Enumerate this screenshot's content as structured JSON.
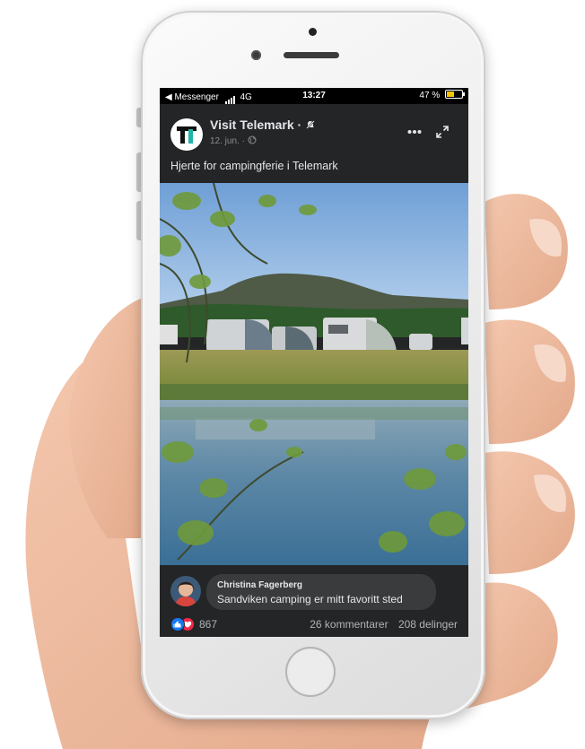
{
  "status_bar": {
    "back_app": "◀ Messenger",
    "network": "4G",
    "time": "13:27",
    "battery": "47 %",
    "battery_level": 0.47,
    "battery_color": "#f5c400"
  },
  "post": {
    "page_name": "Visit Telemark · ",
    "date": "12. jun. · ",
    "text": "Hjerte for campingferie i Telemark",
    "header_icons": [
      "globe-icon",
      "more-icon",
      "expand-icon"
    ],
    "photo_icon": "camping-photo"
  },
  "comment": {
    "author": "Christina Fagerberg",
    "text": "Sandviken camping er mitt favoritt sted"
  },
  "footer": {
    "reaction_count": "867",
    "comments": "26 kommentarer",
    "shares": "208 delinger",
    "reaction_icons": [
      "like-icon",
      "love-icon"
    ]
  },
  "colors": {
    "screen_bg": "#242526",
    "bubble_bg": "#3a3b3c",
    "like_blue": "#1877f2",
    "love_red": "#f02849"
  }
}
